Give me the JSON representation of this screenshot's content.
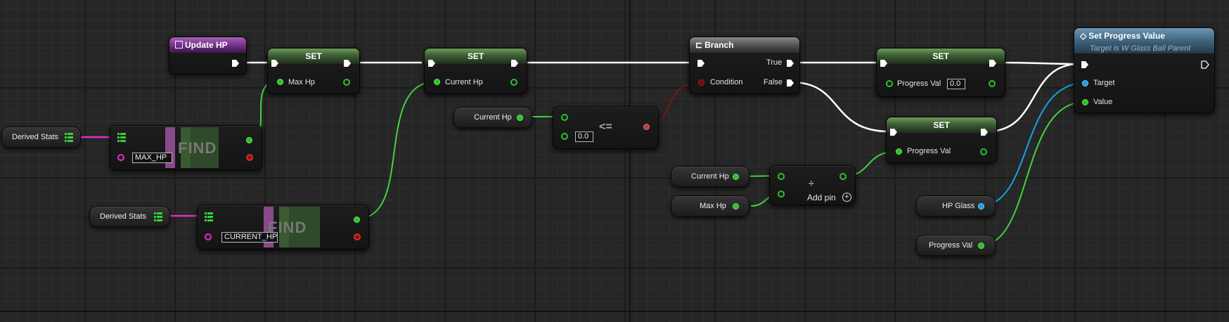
{
  "colors": {
    "exec_wire": "#ffffff",
    "float_wire": "#3fd43f",
    "bool_wire": "#8a1414",
    "map_wire": "#e030d0",
    "object_wire": "#1a9fe0",
    "set_header": "#4c7a3f",
    "event_header": "#8a3fa0",
    "branch_header": "#6a6a6a",
    "function_header": "#4e7895"
  },
  "nodes": {
    "update_hp": {
      "title": "Update HP",
      "icon": "event-icon"
    },
    "set_max_hp": {
      "title": "SET",
      "var": "Max Hp"
    },
    "set_current_hp": {
      "title": "SET",
      "var": "Current Hp"
    },
    "branch": {
      "title": "Branch",
      "icon": "branch-icon",
      "true_label": "True",
      "false_label": "False",
      "condition_label": "Condition"
    },
    "set_progress_true": {
      "title": "SET",
      "var": "Progress Val",
      "value": "0.0"
    },
    "set_progress_false": {
      "title": "SET",
      "var": "Progress Val"
    },
    "set_progress_value": {
      "title": "Set Progress Value",
      "subtitle": "Target is W Glass Ball Parent",
      "icon": "function-icon",
      "target_label": "Target",
      "value_label": "Value"
    },
    "find_max": {
      "label": "FIND",
      "key": "MAX_HP"
    },
    "find_current": {
      "label": "FIND",
      "key": "CURRENT_HP"
    },
    "compare": {
      "op": "<=",
      "value": "0.0"
    },
    "divide": {
      "op": "÷",
      "add_pin": "Add pin"
    }
  },
  "getters": {
    "derived_stats_1": "Derived Stats",
    "derived_stats_2": "Derived Stats",
    "current_hp_1": "Current Hp",
    "current_hp_2": "Current Hp",
    "max_hp": "Max Hp",
    "hp_glass": "HP Glass",
    "progress_val": "Progress Val"
  }
}
